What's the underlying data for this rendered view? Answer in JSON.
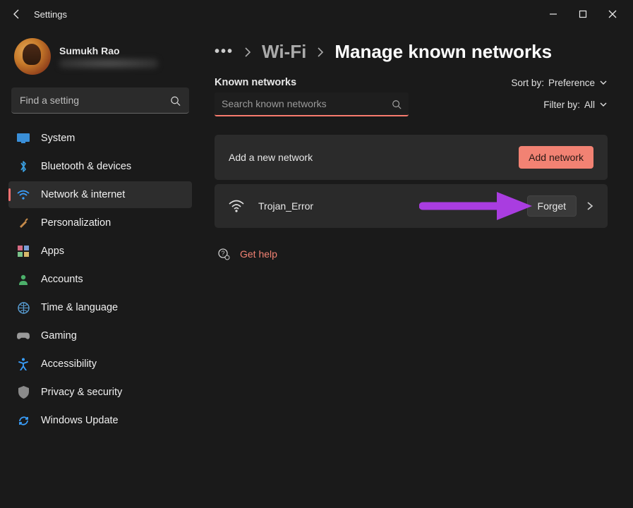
{
  "titlebar": {
    "title": "Settings"
  },
  "profile": {
    "name": "Sumukh Rao"
  },
  "sidebar": {
    "search_placeholder": "Find a setting",
    "items": [
      {
        "icon": "display-icon",
        "label": "System",
        "color": "#3aa0ff"
      },
      {
        "icon": "bluetooth-icon",
        "label": "Bluetooth & devices",
        "color": "#3aa0ff"
      },
      {
        "icon": "wifi-icon",
        "label": "Network & internet",
        "color": "#3aa0ff",
        "active": true
      },
      {
        "icon": "brush-icon",
        "label": "Personalization",
        "color": "#c58a4a"
      },
      {
        "icon": "apps-icon",
        "label": "Apps",
        "color": "#d66b84"
      },
      {
        "icon": "person-icon",
        "label": "Accounts",
        "color": "#4cb06a"
      },
      {
        "icon": "globe-icon",
        "label": "Time & language",
        "color": "#5aa0d8"
      },
      {
        "icon": "gamepad-icon",
        "label": "Gaming",
        "color": "#9a9a9a"
      },
      {
        "icon": "accessibility-icon",
        "label": "Accessibility",
        "color": "#3aa0ff"
      },
      {
        "icon": "shield-icon",
        "label": "Privacy & security",
        "color": "#8a8a8a"
      },
      {
        "icon": "sync-icon",
        "label": "Windows Update",
        "color": "#3aa0ff"
      }
    ]
  },
  "breadcrumb": {
    "parent": "Wi-Fi",
    "current": "Manage known networks"
  },
  "known_networks": {
    "heading": "Known networks",
    "sort_label": "Sort by:",
    "sort_value": "Preference",
    "filter_label": "Filter by:",
    "filter_value": "All",
    "search_placeholder": "Search known networks",
    "add_card_label": "Add a new network",
    "add_button": "Add network",
    "items": [
      {
        "ssid": "Trojan_Error",
        "forget_label": "Forget"
      }
    ]
  },
  "help": {
    "label": "Get help"
  },
  "colors": {
    "accent": "#f28273",
    "arrow": "#a93de0"
  }
}
